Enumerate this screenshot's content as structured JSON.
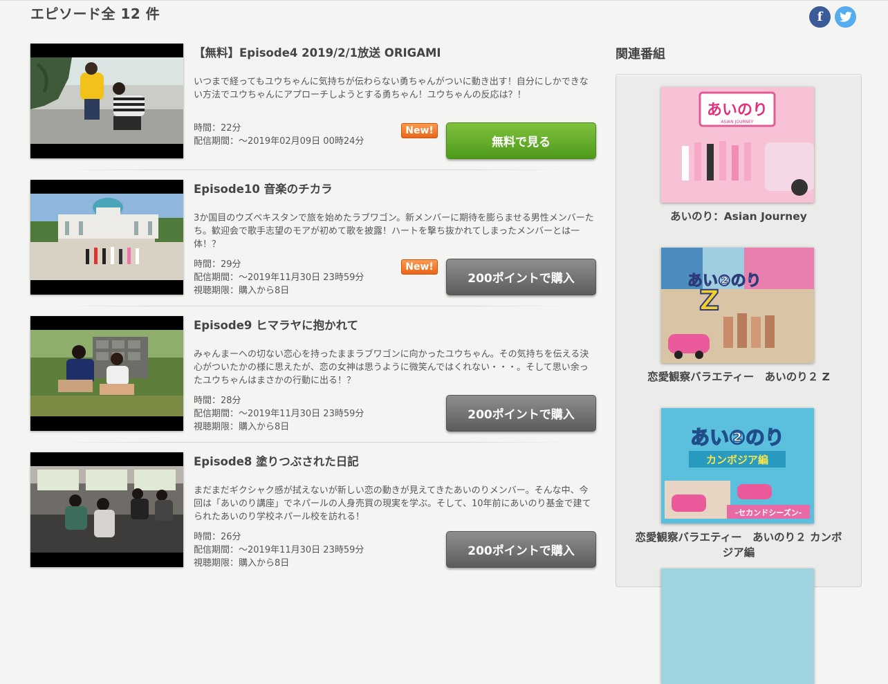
{
  "header": {
    "title": "エピソード全 12 件",
    "facebook_icon": "f",
    "twitter_icon": "t"
  },
  "episodes": [
    {
      "title": "【無料】Episode4 2019/2/1放送 ORIGAMI",
      "description": "いつまで経ってもユウちゃんに気持ちが伝わらない勇ちゃんがついに動き出す！自分にしかできない方法でユウちゃんにアプローチしようとする勇ちゃん！ユウちゃんの反応は？！",
      "duration": "時間：22分",
      "period": "配信期間：～2019年02月09日 00時24分",
      "viewing_limit": "",
      "badge": "New!",
      "button_label": "無料で見る"
    },
    {
      "title": "Episode10 音楽のチカラ",
      "description": "3か国目のウズベキスタンで旅を始めたラブワゴン。新メンバーに期待を膨らませる男性メンバーたち。歓迎会で歌手志望のモアが初めて歌を披露！ハートを撃ち抜かれてしまったメンバーとは一体！？",
      "duration": "時間：29分",
      "period": "配信期間：～2019年11月30日 23時59分",
      "viewing_limit": "視聴期限：購入から8日",
      "badge": "New!",
      "button_label": "200ポイントで購入"
    },
    {
      "title": "Episode9 ヒマラヤに抱かれて",
      "description": "みゃんまーへの切ない恋心を持ったままラブワゴンに向かったユウちゃん。その気持ちを伝える決心がついたかの様に思えたが、恋の女神は思うように微笑んではくれない・・・。そして思い余ったユウちゃんはまさかの行動に出る！？",
      "duration": "時間：28分",
      "period": "配信期間：～2019年11月30日 23時59分",
      "viewing_limit": "視聴期限：購入から8日",
      "badge": "",
      "button_label": "200ポイントで購入"
    },
    {
      "title": "Episode8 塗りつぶされた日記",
      "description": "まだまだギクシャク感が拭えないが新しい恋の動きが見えてきたあいのりメンバー。そんな中、今回は「あいのり講座」でネパールの人身売買の現実を学ぶ。そして、10年前にあいのり基金で建てられたあいのり学校ネパール校を訪れる！",
      "duration": "時間：26分",
      "period": "配信期間：～2019年11月30日 23時59分",
      "viewing_limit": "視聴期限：購入から8日",
      "badge": "",
      "button_label": "200ポイントで購入"
    }
  ],
  "sidebar": {
    "title": "関連番組",
    "items": [
      {
        "label": "あいのり：Asian Journey",
        "logo_text": "あいのり",
        "logo_sub": "ASIAN JOURNEY"
      },
      {
        "label": "恋愛観察バラエティー　あいのり２ Z",
        "logo_text": "あい②のり"
      },
      {
        "label": "恋愛観察バラエティー　あいのり２ カンボジア編",
        "logo_text": "あい②のり",
        "logo_sub": "カンボジア編",
        "logo_ribbon": "-セカンドシーズン-"
      }
    ]
  }
}
